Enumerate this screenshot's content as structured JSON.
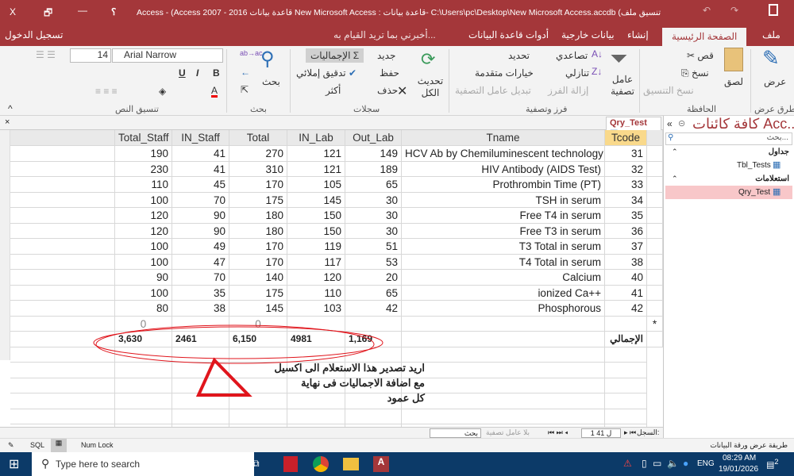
{
  "title_bar": {
    "title": "Access - (Access 2007 - 2016 قاعدة بيانات New Microsoft Access : قاعدة بيانات- C:\\Users\\pc\\Desktop\\New Microsoft Access.accdb (تنسيق ملف",
    "help": "؟",
    "minimize": "—",
    "restore": "🗗",
    "close": "X"
  },
  "tabs": {
    "file": "ملف",
    "home": "الصفحة الرئيسية",
    "create": "إنشاء",
    "external": "بيانات خارجية",
    "dbtools": "أدوات قاعدة البيانات",
    "tell_me": "أخبرني بما تريد القيام به...",
    "sign_in": "تسجيل الدخول"
  },
  "ribbon": {
    "views": {
      "view": "عرض",
      "group": "طرق عرض"
    },
    "clipboard": {
      "paste": "لصق",
      "cut": "قص",
      "copy": "نسخ",
      "format_painter": "نسخ التنسيق",
      "group": "الحافظة"
    },
    "sort_filter": {
      "filter": "عامل تصفية",
      "ascending": "تصاعدي",
      "descending": "تنازلي",
      "remove_sort": "إزالة الفرز",
      "selection": "تحديد",
      "advanced": "خيارات متقدمة",
      "toggle_filter": "تبديل عامل التصفية",
      "group": "فرز وتصفية"
    },
    "records": {
      "refresh_all": "تحديث الكل",
      "new": "جديد",
      "save": "حفظ",
      "delete": "حذف",
      "totals": "الإجماليات",
      "spelling": "تدقيق إملائي",
      "more": "أكثر",
      "group": "سجلات"
    },
    "find": {
      "find": "بحث",
      "group": "بحث"
    },
    "text_formatting": {
      "font_name": "Arial Narrow",
      "font_size": "14",
      "bold": "B",
      "italic": "I",
      "underline": "U",
      "font_color": "A",
      "group": "تنسيق النص"
    }
  },
  "query_tab": "Qry_Test",
  "table": {
    "headers": [
      "Tcode",
      "Tname",
      "Out_Lab",
      "IN_Lab",
      "Total",
      "IN_Staff",
      "Total_Staff"
    ],
    "rows": [
      [
        "31",
        "HCV Ab by Chemiluminescent technology",
        "149",
        "121",
        "270",
        "41",
        "190"
      ],
      [
        "32",
        "HIV Antibody (AIDS Test)",
        "189",
        "121",
        "310",
        "41",
        "230"
      ],
      [
        "33",
        "Prothrombin Time (PT)",
        "65",
        "105",
        "170",
        "45",
        "110"
      ],
      [
        "34",
        "TSH in serum",
        "30",
        "145",
        "175",
        "70",
        "100"
      ],
      [
        "35",
        "Free T4 in serum",
        "30",
        "150",
        "180",
        "90",
        "120"
      ],
      [
        "36",
        "Free T3 in serum",
        "30",
        "150",
        "180",
        "90",
        "120"
      ],
      [
        "37",
        "T3 Total in serum",
        "51",
        "119",
        "170",
        "49",
        "100"
      ],
      [
        "38",
        "T4 Total in serum",
        "53",
        "117",
        "170",
        "47",
        "100"
      ],
      [
        "40",
        "Calcium",
        "20",
        "120",
        "140",
        "70",
        "90"
      ],
      [
        "41",
        "ionized Ca++",
        "65",
        "110",
        "175",
        "35",
        "100"
      ],
      [
        "42",
        "Phosphorous",
        "42",
        "103",
        "145",
        "38",
        "80"
      ]
    ],
    "new_row": {
      "marker": "*",
      "total": "0",
      "total_staff": "0"
    },
    "totals_row": {
      "label": "الإجمالي",
      "out_lab": "1,169",
      "in_lab": "4981",
      "total": "6,150",
      "in_staff": "2461",
      "total_staff": "3,630"
    }
  },
  "annotation": {
    "line1": "اريد تصدير هذا الاستعلام الى اكسيل",
    "line2": "مع اضافة الاجماليات فى نهاية",
    "line3": "كل عمود"
  },
  "nav_pane": {
    "title": "كافة كائنات Acc...",
    "search_placeholder": "بحث...",
    "tables_group": "جداول",
    "tables": [
      "Tbl_Tests"
    ],
    "queries_group": "استعلامات",
    "queries": [
      "Qry_Test"
    ]
  },
  "record_nav": {
    "label": "السجل:",
    "position": "1 ل 41",
    "filter": "بلا عامل تصفية",
    "search": "بحث"
  },
  "status_bar": {
    "left": "طريقة عرض ورقة البيانات",
    "num_lock": "Num Lock",
    "sql": "SQL"
  },
  "taskbar": {
    "search": "Type here to search",
    "lang": "ENG",
    "time": "08:29 AM",
    "date": "19/01/2026",
    "notifications": "2"
  },
  "colors": {
    "accent": "#a4373a",
    "header_selected": "#f9d98b",
    "nav_selected": "#f8c7c9",
    "annotation": "#e0151c"
  }
}
